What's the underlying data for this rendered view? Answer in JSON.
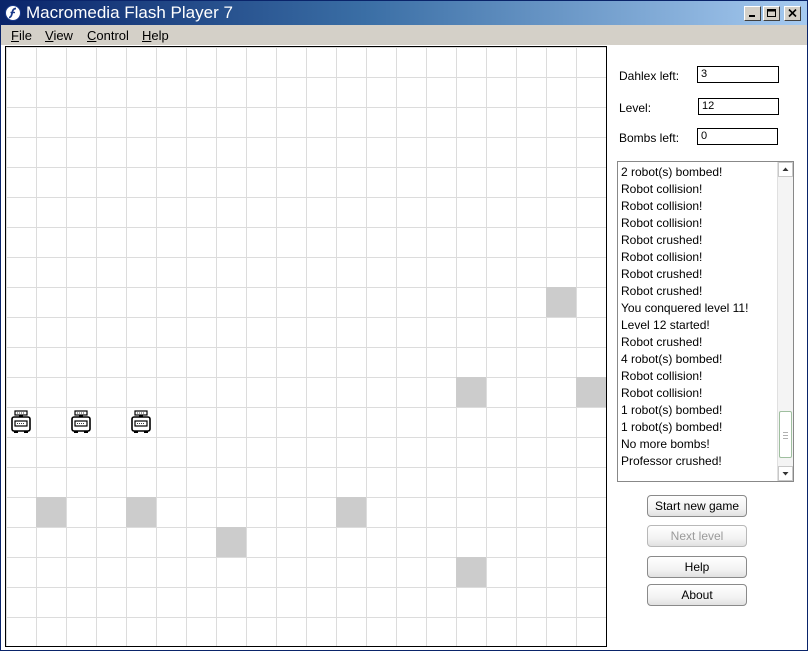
{
  "window": {
    "title": "Macromedia Flash Player 7"
  },
  "menubar": {
    "items": [
      {
        "label": "ile",
        "mnemonic": "F"
      },
      {
        "label": "iew",
        "mnemonic": "V"
      },
      {
        "label": "ontrol",
        "mnemonic": "C"
      },
      {
        "label": "elp",
        "mnemonic": "H"
      }
    ]
  },
  "board": {
    "cols": 20,
    "rows": 20,
    "blocks": [
      {
        "col": 18,
        "row": 8
      },
      {
        "col": 15,
        "row": 11
      },
      {
        "col": 19,
        "row": 11
      },
      {
        "col": 1,
        "row": 15
      },
      {
        "col": 4,
        "row": 15
      },
      {
        "col": 11,
        "row": 15
      },
      {
        "col": 7,
        "row": 16
      },
      {
        "col": 15,
        "row": 17
      }
    ],
    "robots": [
      {
        "col": 0,
        "row": 12
      },
      {
        "col": 2,
        "row": 12
      },
      {
        "col": 4,
        "row": 12
      }
    ],
    "block_color": "#cccccc",
    "grid_color": "#dcdcdc"
  },
  "panel": {
    "dahlex_label": "Dahlex left:",
    "dahlex_value": "3",
    "level_label": "Level:",
    "level_value": "12",
    "bombs_label": "Bombs left:",
    "bombs_value": "0"
  },
  "log": [
    "2 robot(s) bombed!",
    "Robot collision!",
    "Robot collision!",
    "Robot collision!",
    "Robot crushed!",
    "Robot collision!",
    "Robot crushed!",
    "Robot crushed!",
    "You conquered level 11!",
    "Level 12 started!",
    "Robot crushed!",
    "4 robot(s) bombed!",
    "Robot collision!",
    "Robot collision!",
    "1 robot(s) bombed!",
    "1 robot(s) bombed!",
    "No more bombs!",
    "Professor crushed!"
  ],
  "buttons": {
    "start_new_game": "Start new game",
    "next_level": "Next level",
    "help": "Help",
    "about": "About"
  }
}
